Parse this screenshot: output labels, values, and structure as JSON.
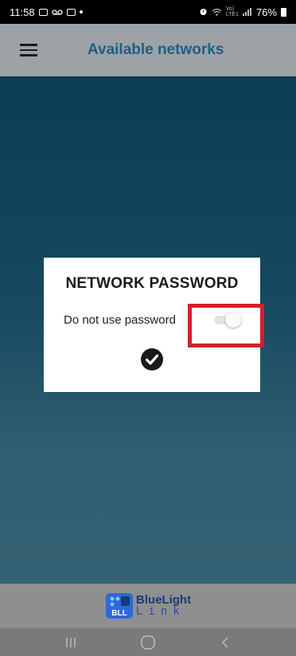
{
  "status_bar": {
    "time": "11:58",
    "battery": "76%",
    "icons": [
      "photo-icon",
      "voicemail-icon",
      "mail-icon",
      "dot-icon",
      "alarm-icon",
      "wifi-icon",
      "volte-icon",
      "signal-icon",
      "battery-icon"
    ]
  },
  "app_bar": {
    "menu_icon": "hamburger-menu-icon",
    "title": "Available networks"
  },
  "dialog": {
    "title": "NETWORK PASSWORD",
    "label": "Do not use password",
    "toggle_on": false,
    "confirm_icon": "check-circle-icon"
  },
  "footer": {
    "logo_name": "BlueLight",
    "logo_sub": "Link"
  },
  "nav_bar": {
    "buttons": [
      "recent-apps-icon",
      "home-icon",
      "back-icon"
    ]
  },
  "colors": {
    "accent": "#1e5e86",
    "highlight": "#d3202d",
    "logo": "#183a78"
  }
}
